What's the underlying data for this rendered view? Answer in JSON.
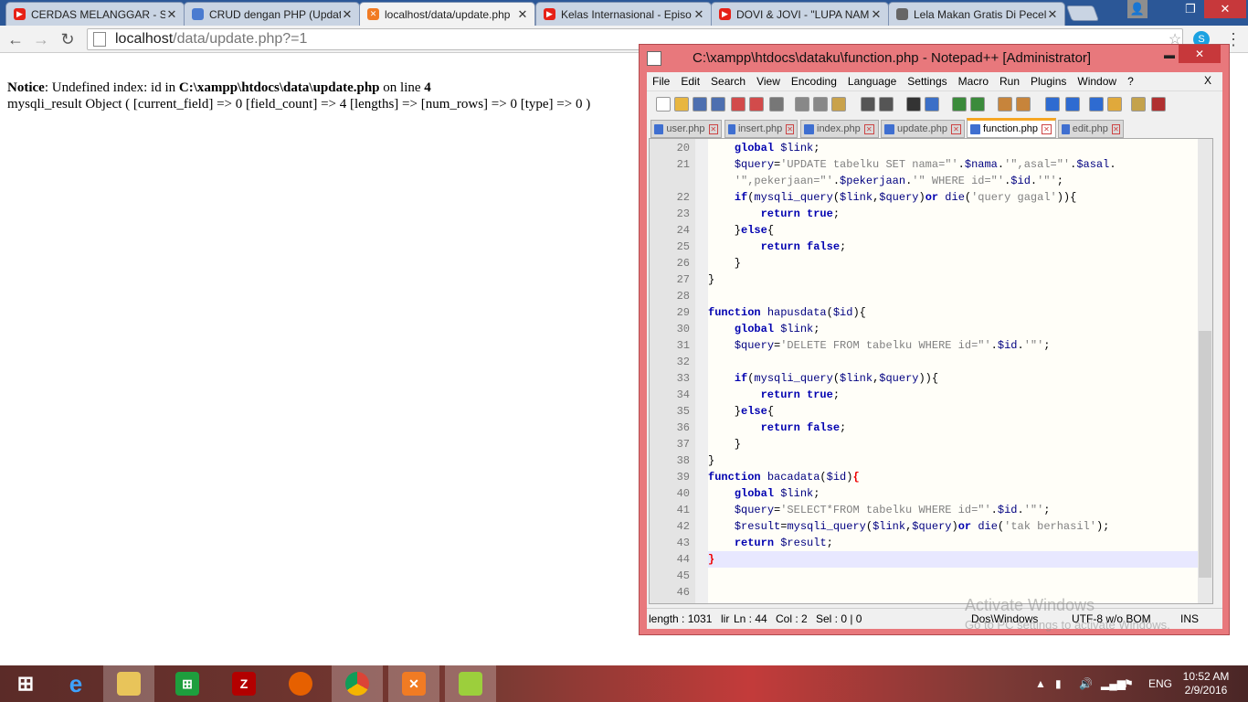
{
  "browser": {
    "tabs": [
      {
        "title": "CERDAS MELANGGAR - St",
        "icon": "youtube-icon"
      },
      {
        "title": "CRUD dengan PHP (Updat",
        "icon": "page-icon"
      },
      {
        "title": "localhost/data/update.php",
        "icon": "xampp-icon"
      },
      {
        "title": "Kelas Internasional - Episo",
        "icon": "youtube-icon"
      },
      {
        "title": "DOVI & JOVI - \"LUPA NAM",
        "icon": "youtube-icon"
      },
      {
        "title": "Lela Makan Gratis Di Pecel",
        "icon": "page-icon"
      }
    ],
    "url_host": "localhost",
    "url_path": "/data/update.php?=1"
  },
  "page": {
    "notice_label": "Notice",
    "notice_text": ": Undefined index: id in ",
    "notice_path": "C:\\xampp\\htdocs\\data\\update.php",
    "notice_line_text": " on line ",
    "notice_line": "4",
    "result_text": "mysqli_result Object ( [current_field] => 0 [field_count] => 4 [lengths] => [num_rows] => 0 [type] => 0 )"
  },
  "npp": {
    "title": "C:\\xampp\\htdocs\\dataku\\function.php - Notepad++ [Administrator]",
    "menu": [
      "File",
      "Edit",
      "Search",
      "View",
      "Encoding",
      "Language",
      "Settings",
      "Macro",
      "Run",
      "Plugins",
      "Window",
      "?"
    ],
    "menu_close": "X",
    "file_tabs": [
      "user.php",
      "insert.php",
      "index.php",
      "update.php",
      "function.php",
      "edit.php"
    ],
    "active_tab": 4,
    "status": {
      "length": "length : 1031",
      "lines": "lir",
      "ln": "Ln : 44",
      "col": "Col : 2",
      "sel": "Sel : 0 | 0",
      "eol": "Dos\\Windows",
      "encoding": "UTF-8 w/o BOM",
      "ins": "INS"
    }
  },
  "watermark": {
    "line1": "Activate Windows",
    "line2": "Go to PC settings to activate Windows."
  },
  "taskbar": {
    "time": "10:52 AM",
    "date": "2/9/2016",
    "lang": "ENG"
  }
}
